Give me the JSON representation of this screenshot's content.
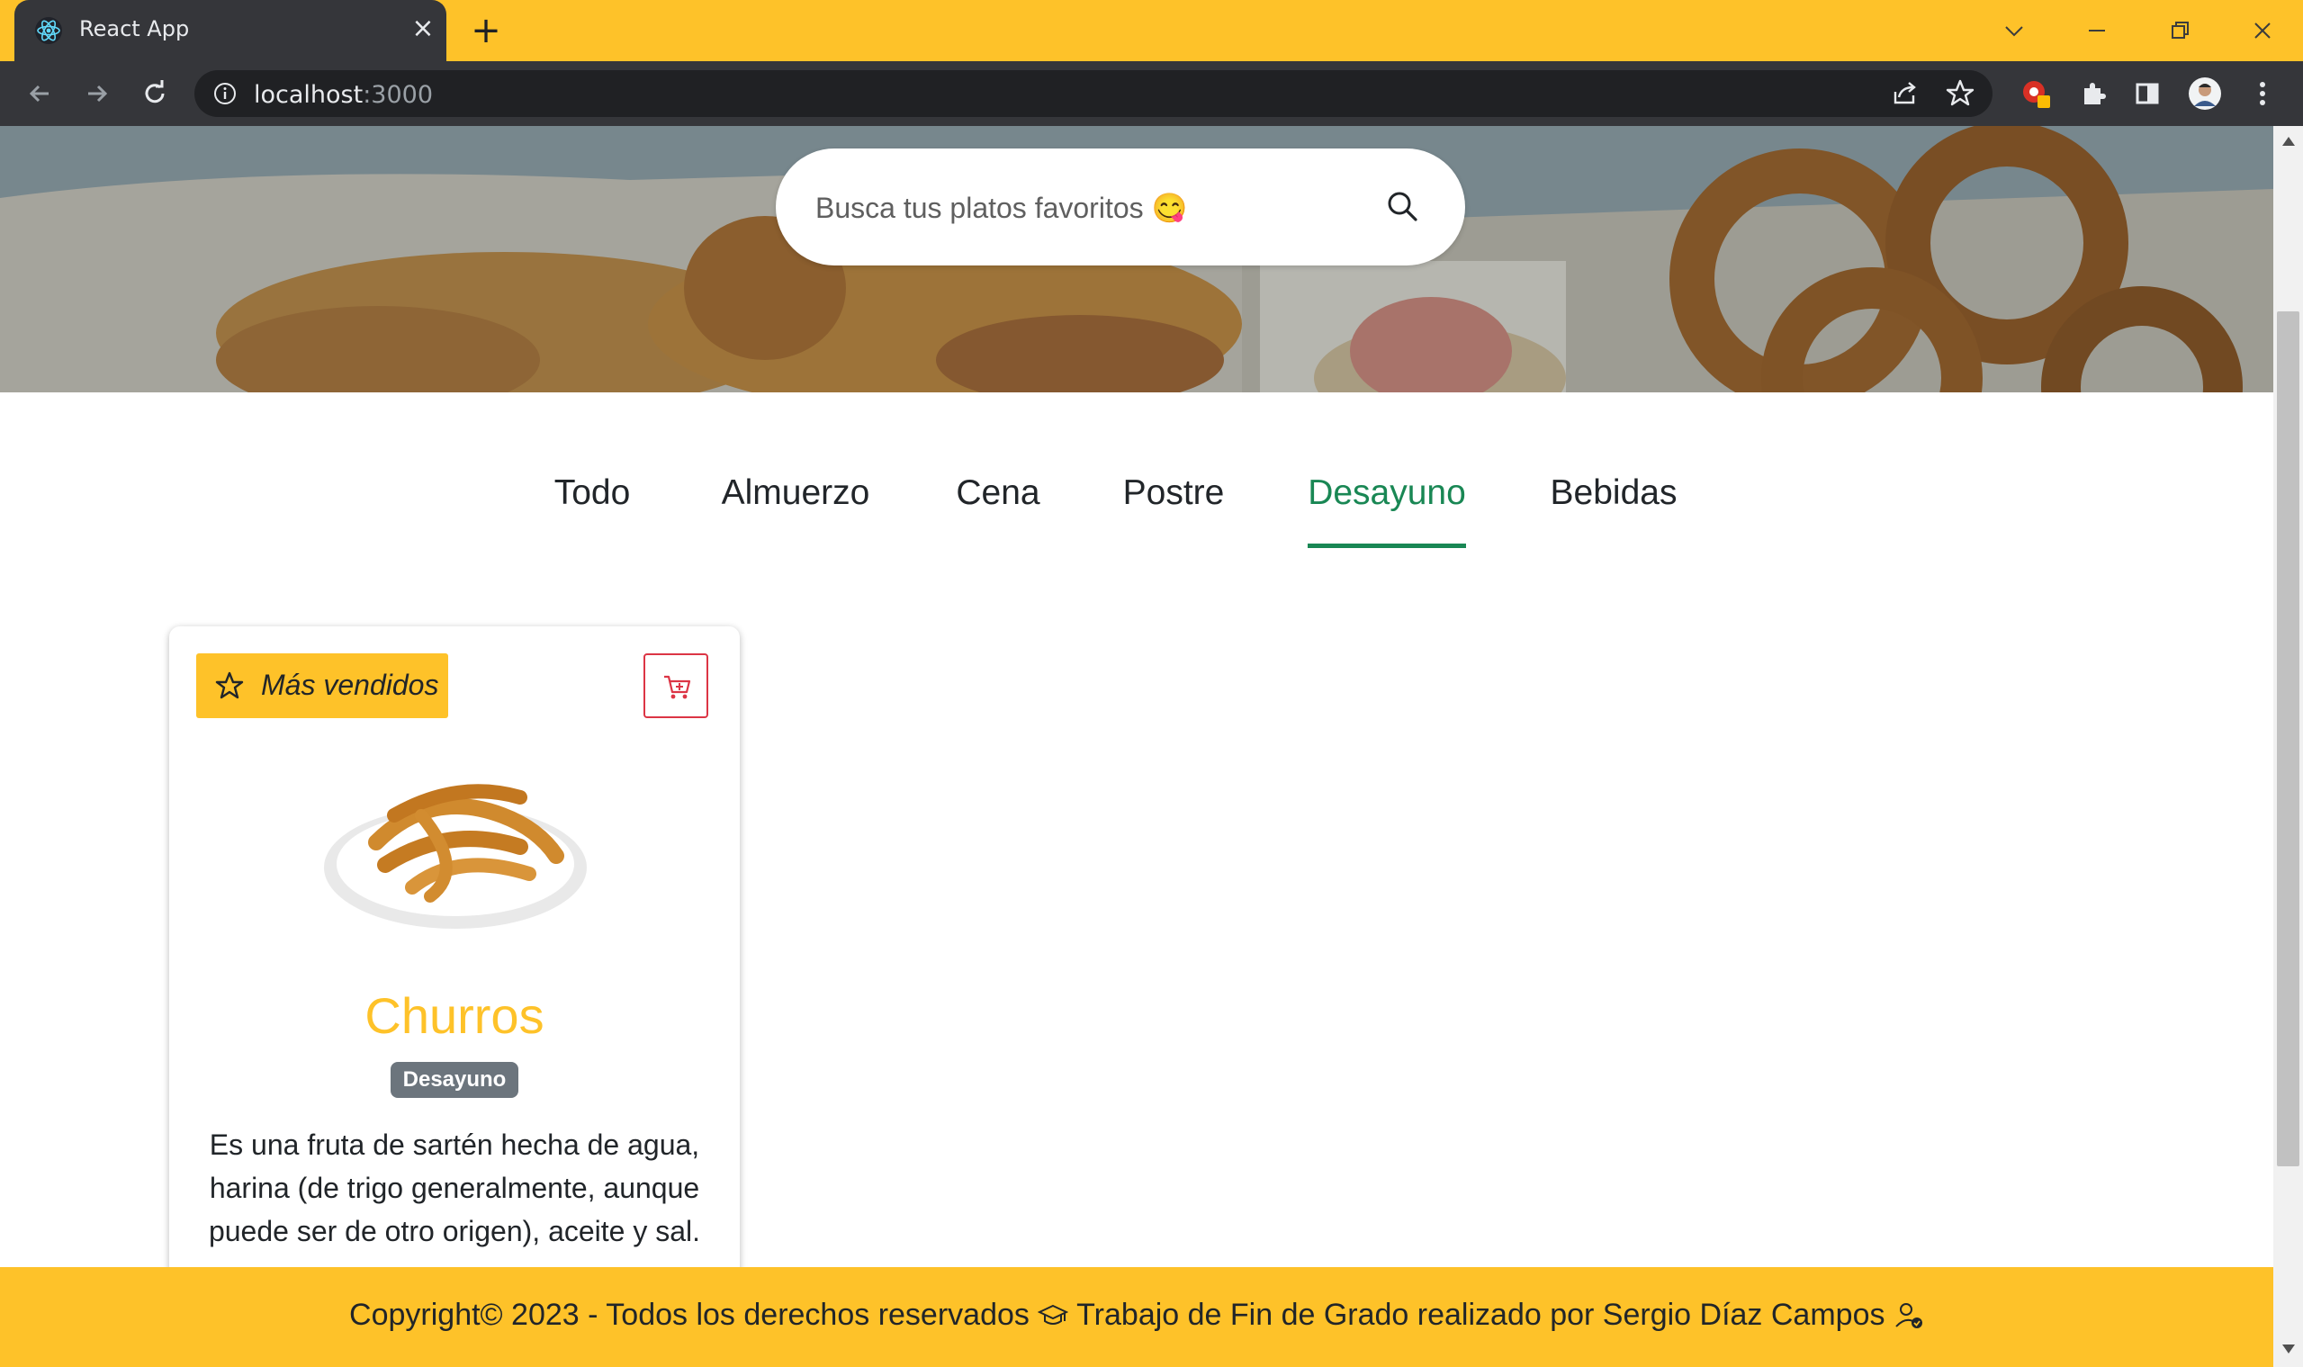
{
  "browser": {
    "tab_title": "React App",
    "url_host": "localhost",
    "url_port": ":3000",
    "close_icon": "×",
    "new_tab_icon": "+",
    "accent_color": "#fec229"
  },
  "search": {
    "placeholder": "Busca tus platos favoritos 😋"
  },
  "categories": {
    "items": [
      "Todo",
      "Almuerzo",
      "Cena",
      "Postre",
      "Desayuno",
      "Bebidas"
    ],
    "active": "Desayuno",
    "active_color": "#198754"
  },
  "card": {
    "badge_label": "Más vendidos",
    "dish_name": "Churros",
    "category_badge": "Desayuno",
    "description": "Es una fruta de sartén hecha de agua, harina (de trigo generalmente, aunque puede ser de otro origen), aceite y sal."
  },
  "footer": {
    "text_part1": "Copyright© 2023 - Todos los derechos reservados ",
    "text_part2": " Trabajo de Fin de Grado realizado por Sergio Díaz Campos "
  }
}
